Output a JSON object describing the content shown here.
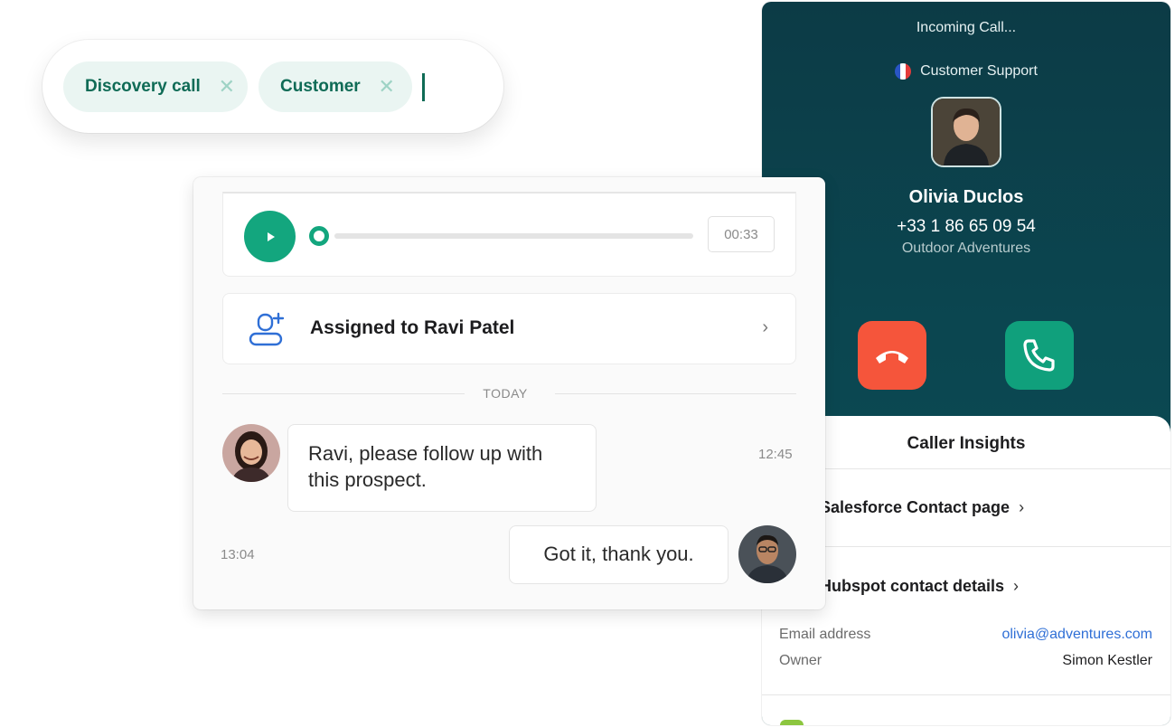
{
  "tags": {
    "chips": [
      {
        "label": "Discovery call",
        "remove_icon": "close-icon"
      },
      {
        "label": "Customer",
        "remove_icon": "close-icon"
      }
    ]
  },
  "call": {
    "status": "Incoming Call...",
    "line_name": "Customer Support",
    "line_flag": "france-flag",
    "caller_name": "Olivia Duclos",
    "caller_phone": "+33 1 86 65 09 54",
    "caller_company": "Outdoor Adventures",
    "decline_icon": "hang-up-icon",
    "accept_icon": "phone-icon",
    "colors": {
      "decline": "#f5553b",
      "accept": "#10a07c",
      "panel": "#0b4650"
    }
  },
  "insights": {
    "title": "Caller Insights",
    "salesforce_link": "Salesforce Contact page",
    "hubspot_link": "Hubspot contact details",
    "fields": {
      "email_label": "Email address",
      "email_value": "olivia@adventures.com",
      "owner_label": "Owner",
      "owner_value": "Simon Kestler"
    }
  },
  "activity": {
    "recording": {
      "time": "00:33",
      "progress": 0.0
    },
    "assigned_label": "Assigned to Ravi Patel",
    "divider_label": "TODAY",
    "messages": [
      {
        "text": "Ravi, please follow up with this prospect.",
        "time": "12:45",
        "side": "left"
      },
      {
        "text": "Got it, thank you.",
        "time": "13:04",
        "side": "right"
      }
    ],
    "accent": "#13a67e"
  }
}
